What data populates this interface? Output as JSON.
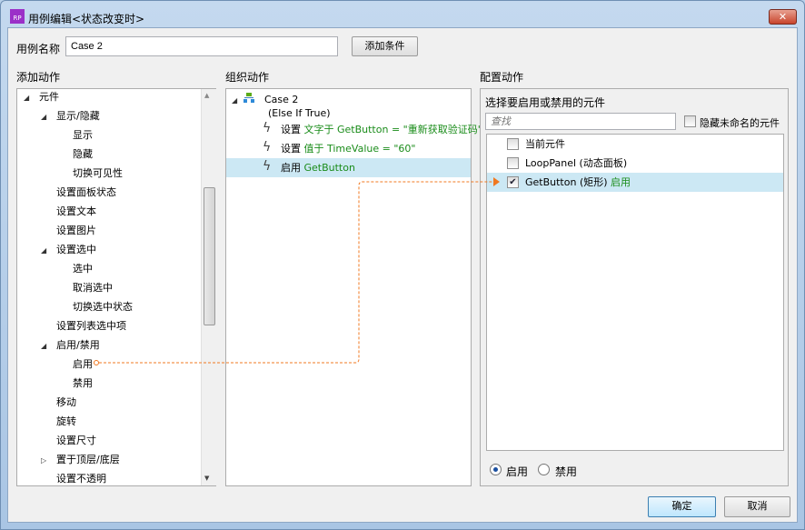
{
  "window": {
    "title": "用例编辑<状态改变时>",
    "logo": "RP",
    "close": "✕"
  },
  "case_name": {
    "label": "用例名称",
    "value": "Case 2",
    "add_condition": "添加条件"
  },
  "sections": {
    "add": "添加动作",
    "organize": "组织动作",
    "configure": "配置动作"
  },
  "tree": [
    {
      "label": "元件",
      "level": 0,
      "arrow": "◢"
    },
    {
      "label": "显示/隐藏",
      "level": 1,
      "arrow": "◢"
    },
    {
      "label": "显示",
      "level": 2
    },
    {
      "label": "隐藏",
      "level": 2
    },
    {
      "label": "切换可见性",
      "level": 2
    },
    {
      "label": "设置面板状态",
      "level": 1
    },
    {
      "label": "设置文本",
      "level": 1
    },
    {
      "label": "设置图片",
      "level": 1
    },
    {
      "label": "设置选中",
      "level": 1,
      "arrow": "◢"
    },
    {
      "label": "选中",
      "level": 2
    },
    {
      "label": "取消选中",
      "level": 2
    },
    {
      "label": "切换选中状态",
      "level": 2
    },
    {
      "label": "设置列表选中项",
      "level": 1
    },
    {
      "label": "启用/禁用",
      "level": 1,
      "arrow": "◢"
    },
    {
      "label": "启用",
      "level": 2
    },
    {
      "label": "禁用",
      "level": 2
    },
    {
      "label": "移动",
      "level": 1
    },
    {
      "label": "旋转",
      "level": 1
    },
    {
      "label": "设置尺寸",
      "level": 1
    },
    {
      "label": "置于顶层/底层",
      "level": 1,
      "arrow": "▷"
    },
    {
      "label": "设置不透明",
      "level": 1
    }
  ],
  "case": {
    "name": "Case 2",
    "condition": "(Else If True)",
    "actions": [
      {
        "verb": "设置",
        "detail": "文字于 GetButton = \"重新获取验证码\""
      },
      {
        "verb": "设置",
        "detail": "值于 TimeValue = \"60\""
      },
      {
        "verb": "启用",
        "detail": "GetButton"
      }
    ]
  },
  "config": {
    "heading": "选择要启用或禁用的元件",
    "search_placeholder": "查找",
    "hide_unnamed": "隐藏未命名的元件",
    "items": [
      {
        "label": "当前元件",
        "checked": false,
        "status": ""
      },
      {
        "label": "LoopPanel (动态面板)",
        "checked": false,
        "status": ""
      },
      {
        "label": "GetButton (矩形)",
        "checked": true,
        "status": "启用"
      }
    ],
    "radio_enable": "启用",
    "radio_disable": "禁用",
    "selected": "启用"
  },
  "buttons": {
    "ok": "确定",
    "cancel": "取消"
  },
  "colors": {
    "selection": "#cce8f4",
    "connector": "#f07820",
    "green": "#1a8c1a"
  }
}
